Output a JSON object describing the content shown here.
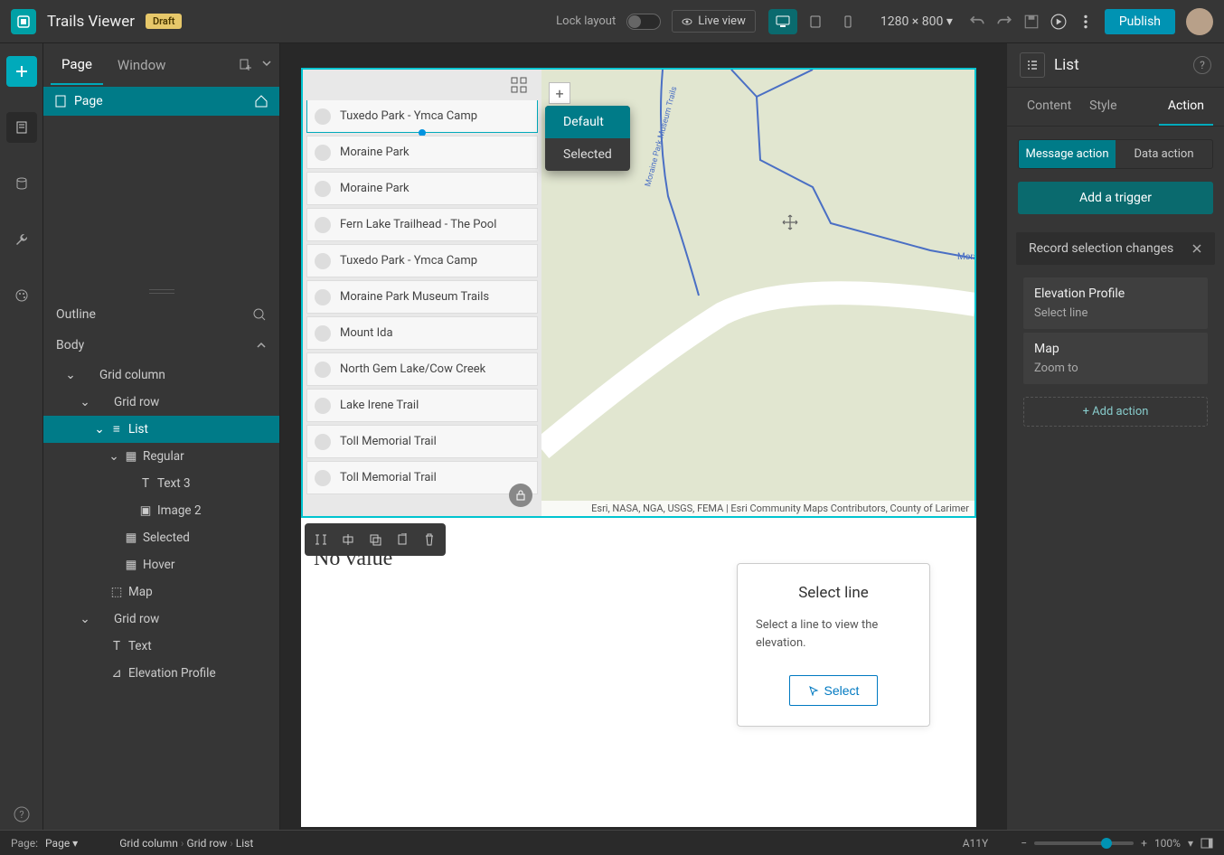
{
  "header": {
    "app_title": "Trails Viewer",
    "draft": "Draft",
    "lock_label": "Lock layout",
    "live_view": "Live view",
    "resolution": "1280 × 800",
    "publish": "Publish"
  },
  "left_panel": {
    "tabs": {
      "page": "Page",
      "window": "Window"
    },
    "page_row": "Page",
    "outline": "Outline",
    "body": "Body",
    "tree": [
      {
        "label": "Grid column",
        "indent": 1,
        "tw": "v",
        "icon": ""
      },
      {
        "label": "Grid row",
        "indent": 2,
        "tw": "v",
        "icon": ""
      },
      {
        "label": "List",
        "indent": 3,
        "tw": "v",
        "icon": "list",
        "sel": true
      },
      {
        "label": "Regular",
        "indent": 4,
        "tw": "v",
        "icon": "layout"
      },
      {
        "label": "Text 3",
        "indent": 5,
        "tw": "",
        "icon": "text"
      },
      {
        "label": "Image 2",
        "indent": 5,
        "tw": "",
        "icon": "image"
      },
      {
        "label": "Selected",
        "indent": 4,
        "tw": "",
        "icon": "layout"
      },
      {
        "label": "Hover",
        "indent": 4,
        "tw": "",
        "icon": "layout"
      },
      {
        "label": "Map",
        "indent": 3,
        "tw": "",
        "icon": "map"
      },
      {
        "label": "Grid row",
        "indent": 2,
        "tw": "v",
        "icon": ""
      },
      {
        "label": "Text",
        "indent": 3,
        "tw": "",
        "icon": "text"
      },
      {
        "label": "Elevation Profile",
        "indent": 3,
        "tw": "",
        "icon": "chart"
      }
    ]
  },
  "canvas": {
    "popover": {
      "default": "Default",
      "selected": "Selected"
    },
    "list_items": [
      "Tuxedo Park - Ymca Camp",
      "Moraine Park",
      "Moraine Park",
      "Fern Lake Trailhead - The Pool",
      "Tuxedo Park - Ymca Camp",
      "Moraine Park Museum Trails",
      "Mount Ida",
      "North Gem Lake/Cow Creek",
      "Lake Irene Trail",
      "Toll Memorial Trail",
      "Toll Memorial Trail"
    ],
    "attribution": "Esri, NASA, NGA, USGS, FEMA | Esri Community Maps Contributors, County of Larimer",
    "no_value": "No value",
    "select_card": {
      "title": "Select line",
      "body": "Select a line to view the elevation.",
      "button": "Select"
    },
    "trail_label": "Moraine Park Museum Trails",
    "trail_short": "Mora"
  },
  "right_panel": {
    "title": "List",
    "tabs": {
      "content": "Content",
      "style": "Style",
      "action": "Action"
    },
    "seg": {
      "msg": "Message action",
      "data": "Data action"
    },
    "add_trigger": "Add a trigger",
    "record_header": "Record selection changes",
    "actions": [
      {
        "title": "Elevation Profile",
        "sub": "Select line"
      },
      {
        "title": "Map",
        "sub": "Zoom to"
      }
    ],
    "add_action": "+ Add action"
  },
  "footer": {
    "page_label": "Page:",
    "page_val": "Page",
    "crumbs": [
      "Grid column",
      "Grid row",
      "List"
    ],
    "a11y": "A11Y",
    "zoom": "100%"
  }
}
